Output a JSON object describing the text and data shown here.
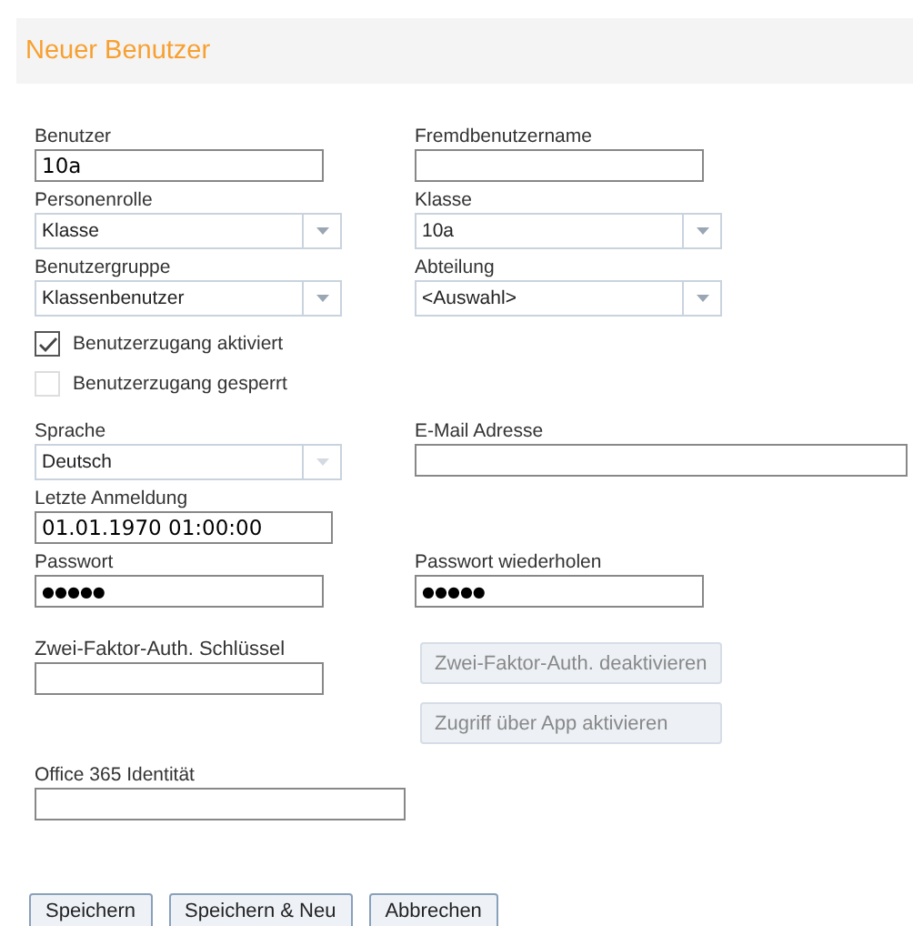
{
  "header": {
    "title": "Neuer Benutzer"
  },
  "rows": [
    {
      "left": {
        "label": "Benutzer",
        "kind": "text",
        "value": "10a"
      },
      "right": {
        "label": "Fremdbenutzername",
        "kind": "text"
      }
    },
    {
      "left": {
        "label": "Personenrolle",
        "kind": "select",
        "value": "Klasse"
      },
      "right": {
        "label": "Klasse",
        "kind": "select",
        "value": "10a"
      }
    },
    {
      "left": {
        "label": "Benutzergruppe",
        "kind": "select",
        "value": "Klassenbenutzer"
      },
      "right": {
        "label": "Abteilung",
        "kind": "select",
        "value": "<Auswahl>"
      }
    }
  ],
  "checkboxes": [
    {
      "label": "Benutzerzugang aktiviert",
      "checked": true,
      "disabled": false
    },
    {
      "label": "Benutzerzugang gesperrt",
      "checked": false,
      "disabled": true
    }
  ],
  "rows2": [
    {
      "left": {
        "label": "Sprache",
        "kind": "select",
        "value": "Deutsch",
        "disabled": true
      },
      "right": {
        "label": "E-Mail Adresse",
        "kind": "wide"
      }
    },
    {
      "left": {
        "label": "Letzte Anmeldung",
        "kind": "text",
        "value": "01.01.1970 01:00:00"
      }
    },
    {
      "left": {
        "label": "Passwort",
        "kind": "password",
        "value": "●●●●●"
      },
      "right": {
        "label": "Passwort wiederholen",
        "kind": "password",
        "value": "●●●●●"
      }
    }
  ],
  "two_factor": {
    "label": "Zwei-Faktor-Auth. Schlüssel",
    "buttons": [
      {
        "label": "Zwei-Faktor-Auth. deaktivieren",
        "disabled": true
      },
      {
        "label": "Zugriff über App aktivieren",
        "disabled": true
      }
    ]
  },
  "office": {
    "label": "Office 365 Identität"
  },
  "buttons": [
    "Speichern",
    "Speichern & Neu",
    "Abbrechen"
  ]
}
